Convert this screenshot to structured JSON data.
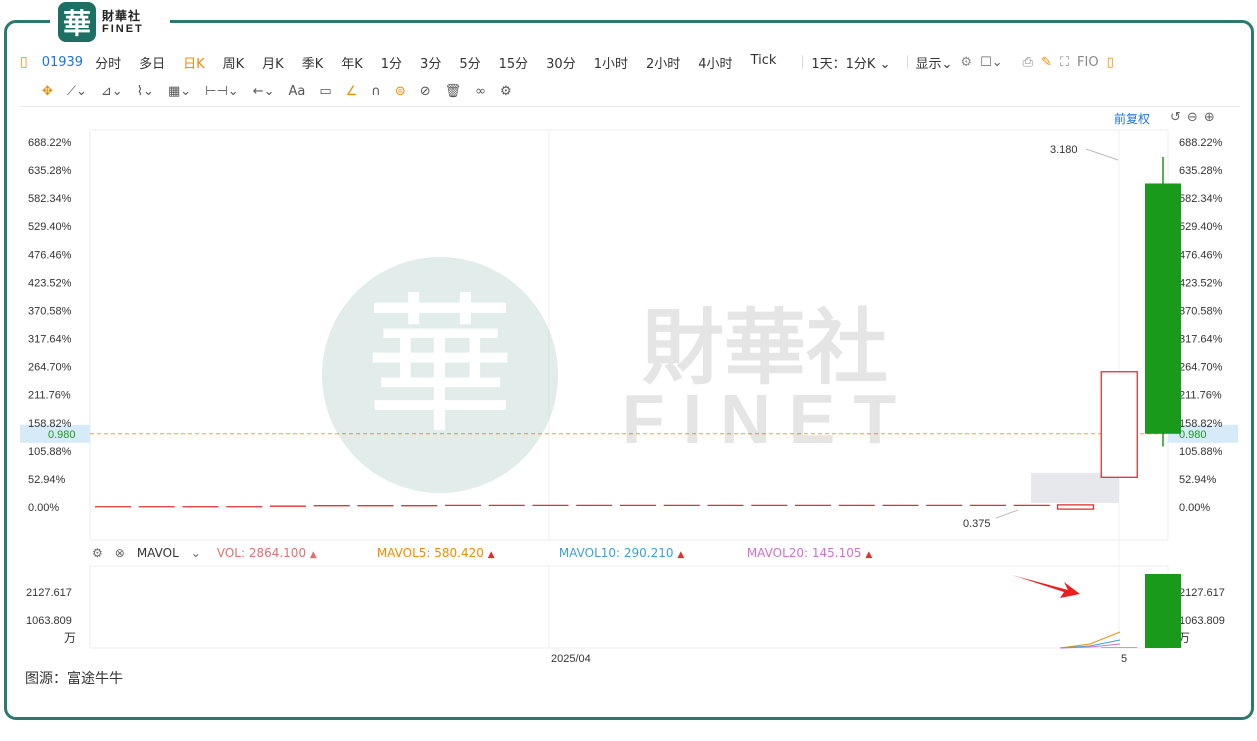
{
  "logo": {
    "cn": "財華社",
    "en": "FINET",
    "seal": "華"
  },
  "toolbar": {
    "symbol": "01939",
    "periods": [
      "分时",
      "多日",
      "日K",
      "周K",
      "月K",
      "季K",
      "年K",
      "1分",
      "3分",
      "5分",
      "15分",
      "30分",
      "1小时",
      "2小时",
      "4小时",
      "Tick"
    ],
    "active_period": "日K",
    "compare": "1天：1分K",
    "display": "显示",
    "fio": "FIO"
  },
  "tools": {
    "text_tool": "Aa"
  },
  "price_axis": {
    "labels": [
      "688.22%",
      "635.28%",
      "582.34%",
      "529.40%",
      "476.46%",
      "423.52%",
      "370.58%",
      "317.64%",
      "264.70%",
      "211.76%",
      "158.82%",
      "105.88%",
      "52.94%",
      "0.00%"
    ],
    "values": [
      688.22,
      635.28,
      582.34,
      529.4,
      476.46,
      423.52,
      370.58,
      317.64,
      264.7,
      211.76,
      158.82,
      105.88,
      52.94,
      0.0
    ],
    "current_price_label": "0.980",
    "current_price_pct": 138
  },
  "annotations": {
    "high_label": "3.180",
    "low_label": "0.375",
    "adjust_label": "前复权"
  },
  "watermark": {
    "cn": "財華社",
    "en": "FINET"
  },
  "volume": {
    "indicator": "MAVOL",
    "vol": "VOL: 2864.100",
    "mavol5": "MAVOL5: 580.420",
    "mavol10": "MAVOL10: 290.210",
    "mavol20": "MAVOL20: 145.105",
    "axis_labels": [
      "2127.617",
      "1063.809"
    ],
    "unit": "万",
    "last_volume": 2864.1
  },
  "x_axis": {
    "label_mid": "2025/04",
    "label_end": "5"
  },
  "source": "图源：富途牛牛",
  "colors": {
    "up": "#1a9a1a",
    "down": "#e03030",
    "accent": "#f08c00",
    "link": "#1a73e8",
    "frame": "#2a7a72"
  },
  "chart_data": {
    "type": "candlestick",
    "y_unit": "%",
    "ylim": [
      0,
      688.22
    ],
    "candles": [
      {
        "idx": 0,
        "open": 0.5,
        "close": 0.5,
        "color": "down"
      },
      {
        "idx": 1,
        "open": 0.5,
        "close": 0.5,
        "color": "down"
      },
      {
        "idx": 2,
        "open": 0.5,
        "close": 0.5,
        "color": "down"
      },
      {
        "idx": 3,
        "open": 0.5,
        "close": 0.5,
        "color": "down"
      },
      {
        "idx": 4,
        "open": 1.5,
        "close": 1.5,
        "color": "down"
      },
      {
        "idx": 5,
        "open": 2.5,
        "close": 2.5,
        "color": "down"
      },
      {
        "idx": 6,
        "open": 2.5,
        "close": 2.5,
        "color": "down"
      },
      {
        "idx": 7,
        "open": 2.5,
        "close": 2.5,
        "color": "down"
      },
      {
        "idx": 8,
        "open": 3,
        "close": 3,
        "color": "down"
      },
      {
        "idx": 9,
        "open": 3,
        "close": 3,
        "color": "down"
      },
      {
        "idx": 10,
        "open": 3,
        "close": 3,
        "color": "down"
      },
      {
        "idx": 11,
        "open": 3,
        "close": 3,
        "color": "down"
      },
      {
        "idx": 12,
        "open": 3,
        "close": 3,
        "color": "down"
      },
      {
        "idx": 13,
        "open": 3,
        "close": 3,
        "color": "down"
      },
      {
        "idx": 14,
        "open": 3,
        "close": 3,
        "color": "down"
      },
      {
        "idx": 15,
        "open": 3,
        "close": 3,
        "color": "down"
      },
      {
        "idx": 16,
        "open": 3,
        "close": 3,
        "color": "down"
      },
      {
        "idx": 17,
        "open": 3,
        "close": 3,
        "color": "down"
      },
      {
        "idx": 18,
        "open": 3,
        "close": 3,
        "color": "down"
      },
      {
        "idx": 19,
        "open": 3,
        "close": 3,
        "color": "down"
      },
      {
        "idx": 20,
        "open": 3,
        "close": 3,
        "color": "down"
      },
      {
        "idx": 21,
        "open": 3,
        "close": 3,
        "color": "down"
      },
      {
        "idx": 22,
        "open": 4,
        "close": -4,
        "color": "down_hollow"
      },
      {
        "idx": 23,
        "open": 255,
        "close": 56,
        "color": "down_hollow"
      },
      {
        "idx": 24,
        "open": 138,
        "close": 610,
        "high": 660,
        "low": 114,
        "color": "up"
      }
    ],
    "volume_bars": [
      {
        "idx": 23,
        "value": 20
      },
      {
        "idx": 24,
        "value": 2864.1
      }
    ],
    "vol_ylim": [
      0,
      2864.1
    ]
  }
}
